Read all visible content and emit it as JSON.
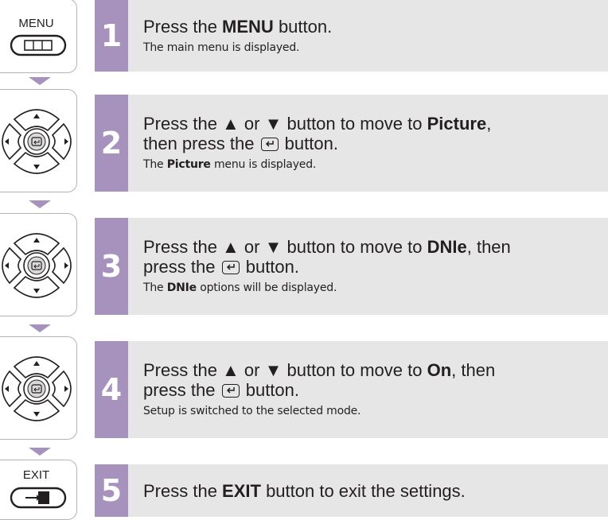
{
  "icons": {
    "menu_label": "MENU",
    "exit_label": "EXIT"
  },
  "steps": [
    {
      "number": "1",
      "line1_a": "Press the ",
      "line1_b": "MENU",
      "line1_c": " button.",
      "sub": "The main menu is displayed."
    },
    {
      "number": "2",
      "line1_a": "Press the ▲ or ▼ button to move to ",
      "line1_b": "Picture",
      "line1_c": ",",
      "line2_a": "then press the ",
      "line2_c": " button.",
      "sub_a": "The ",
      "sub_b": "Picture",
      "sub_c": " menu is displayed."
    },
    {
      "number": "3",
      "line1_a": "Press the ▲ or ▼ button to move to ",
      "line1_b": "DNIe",
      "line1_c": ", then",
      "line2_a": "press the ",
      "line2_c": " button.",
      "sub_a": "The ",
      "sub_b": "DNIe",
      "sub_c": " options will be displayed."
    },
    {
      "number": "4",
      "line1_a": "Press the ▲ or ▼ button to move to ",
      "line1_b": "On",
      "line1_c": ", then",
      "line2_a": "press the ",
      "line2_c": " button.",
      "sub": "Setup is switched to the selected mode."
    },
    {
      "number": "5",
      "line1_a": "Press the ",
      "line1_b": "EXIT",
      "line1_c": " button to exit the settings."
    }
  ],
  "colors": {
    "accent": "#a792bd",
    "row_bg": "#e6e6e7",
    "text": "#231f20"
  }
}
